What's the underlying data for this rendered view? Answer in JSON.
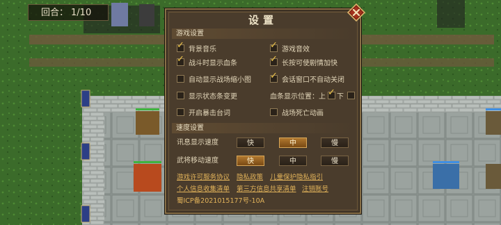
{
  "hud": {
    "turn_label": "回合：",
    "turn_value": "1/10"
  },
  "dialog": {
    "title": "设置",
    "close_icon": "close-x-icon",
    "game_section": "游戏设置",
    "options": [
      {
        "label": "背景音乐",
        "checked": true
      },
      {
        "label": "游戏音效",
        "checked": true
      },
      {
        "label": "战斗时显示血条",
        "checked": true
      },
      {
        "label": "长按可使剧情加快",
        "checked": true
      },
      {
        "label": "自动显示战场缩小图",
        "checked": false
      },
      {
        "label": "会话窗口不自动关闭",
        "checked": true
      },
      {
        "label": "显示状态条变更",
        "checked": false
      },
      {
        "label": "开启暴击台词",
        "checked": false
      },
      {
        "label": "战场死亡动画",
        "checked": false
      }
    ],
    "hp_bar_position": {
      "label": "血条显示位置：上",
      "top_checked": true,
      "bottom_label": "下",
      "bottom_checked": false
    },
    "speed_section": "速度设置",
    "speeds": [
      {
        "label": "讯息显示速度",
        "options": [
          "快",
          "中",
          "慢"
        ],
        "selected": "中"
      },
      {
        "label": "武将移动速度",
        "options": [
          "快",
          "中",
          "慢"
        ],
        "selected": "快"
      }
    ],
    "links": {
      "license": "游戏许可服务协议",
      "privacy": "隐私政策",
      "child_privacy": "儿童保护隐私指引",
      "personal_info": "个人信息收集清单",
      "third_party": "第三方信息共享清单",
      "cancel_account": "注销账号"
    },
    "icp": "蜀ICP备2021015177号-10A"
  },
  "colors": {
    "accent": "#f2c84b",
    "panel": "#4a3c2c",
    "link": "#e2b35a"
  }
}
